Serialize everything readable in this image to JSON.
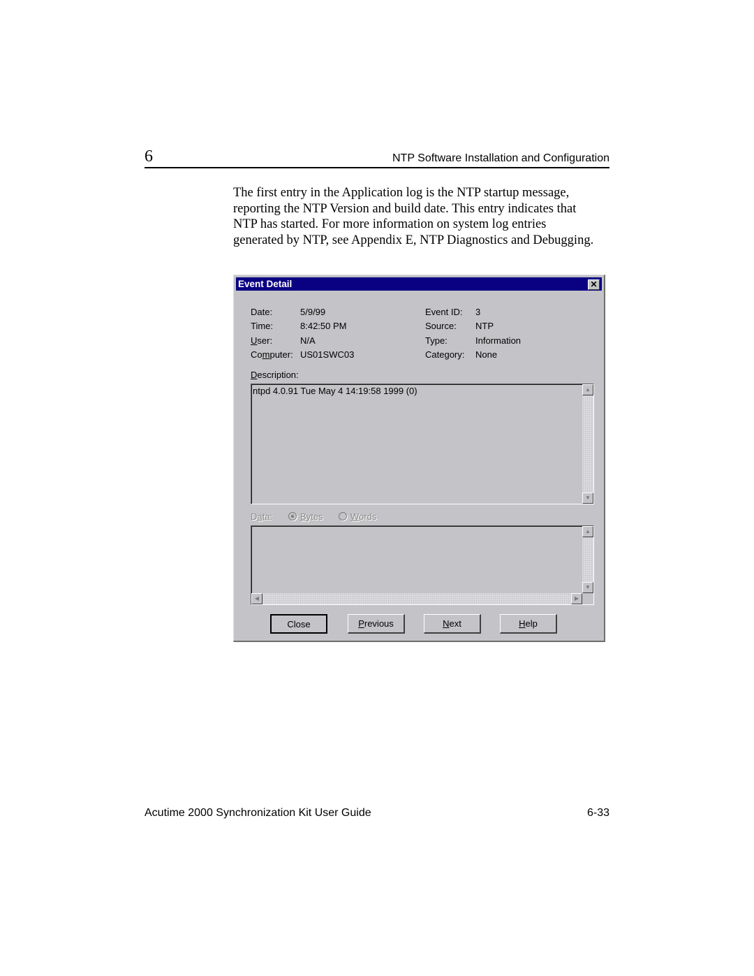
{
  "header": {
    "chapter_number": "6",
    "chapter_title": "NTP Software Installation and Configuration"
  },
  "body": {
    "lines": [
      "The first entry in the Application log is the NTP startup message,",
      "reporting the NTP Version and build date. This entry indicates that",
      "NTP has started. For more information on system log entries",
      "generated by NTP, see Appendix E, NTP Diagnostics and Debugging."
    ]
  },
  "dialog": {
    "title": "Event Detail",
    "close_glyph": "✕",
    "fields": {
      "date_label": "Date:",
      "date_value": "5/9/99",
      "time_label": "Time:",
      "time_value": "8:42:50 PM",
      "user_label_prefix": "",
      "user_label_accel": "U",
      "user_label_rest": "ser:",
      "user_value": "N/A",
      "computer_label_prefix": "Co",
      "computer_label_accel": "m",
      "computer_label_rest": "puter:",
      "computer_value": "US01SWC03",
      "event_id_label": "Event ID:",
      "event_id_value": "3",
      "source_label": "Source:",
      "source_value": "NTP",
      "type_label": "Type:",
      "type_value": "Information",
      "category_label": "Category:",
      "category_value": "None"
    },
    "description": {
      "label_accel": "D",
      "label_rest": "escription:",
      "text": "ntpd 4.0.91 Tue May  4 14:19:58 1999 (0)"
    },
    "data_section": {
      "label_prefix": "D",
      "label_accel": "a",
      "label_rest": "ta:",
      "radio_bytes_accel": "B",
      "radio_bytes_rest": "ytes",
      "radio_words_accel": "W",
      "radio_words_rest": "ords",
      "selected": "Bytes"
    },
    "scroll_glyphs": {
      "up": "▲",
      "down": "▼",
      "left": "◀",
      "right": "▶"
    },
    "buttons": {
      "close": "Close",
      "previous_accel": "P",
      "previous_rest": "revious",
      "next_accel": "N",
      "next_rest": "ext",
      "help_accel": "H",
      "help_rest": "elp"
    }
  },
  "footer": {
    "guide_title": "Acutime 2000 Synchronization Kit User Guide",
    "page_number": "6-33"
  }
}
